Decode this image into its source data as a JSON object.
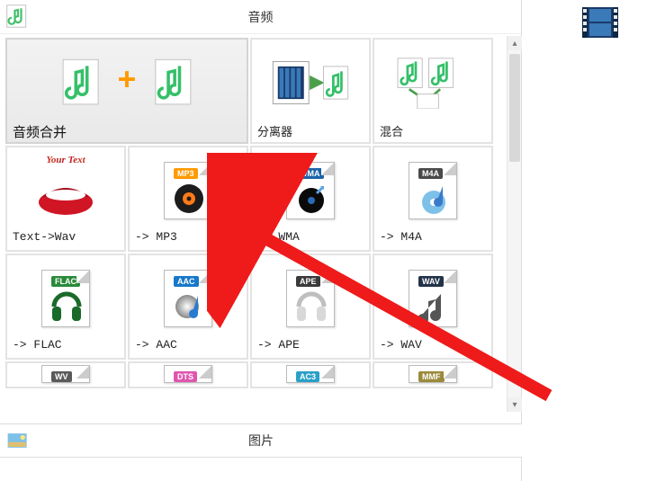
{
  "sections": {
    "audio_title": "音频",
    "pictures_title": "图片"
  },
  "tiles": {
    "merge": {
      "label": "音频合并"
    },
    "splitter": {
      "label": "分离器"
    },
    "mix": {
      "label": "混合"
    },
    "text2wav": {
      "label": "Text->Wav",
      "badge_text": "Your Text"
    },
    "mp3": {
      "label": "-> MP3",
      "badge": "MP3",
      "badge_color": "#ff9a00"
    },
    "wma": {
      "label": "-> WMA",
      "badge": "WMA",
      "badge_color": "#1d63a8"
    },
    "m4a": {
      "label": "-> M4A",
      "badge": "M4A",
      "badge_color": "#4a4a4a"
    },
    "flac": {
      "label": "-> FLAC",
      "badge": "FLAC",
      "badge_color": "#2a8a3a"
    },
    "aac": {
      "label": "-> AAC",
      "badge": "AAC",
      "badge_color": "#1878c9"
    },
    "ape": {
      "label": "-> APE",
      "badge": "APE",
      "badge_color": "#3a3a3a"
    },
    "wav": {
      "label": "-> WAV",
      "badge": "WAV",
      "badge_color": "#223349"
    },
    "wv": {
      "label": "",
      "badge": "WV",
      "badge_color": "#5a5a5a"
    },
    "dts": {
      "label": "",
      "badge": "DTS",
      "badge_color": "#e055b0"
    },
    "ac3": {
      "label": "",
      "badge": "AC3",
      "badge_color": "#2aa0c8"
    },
    "mmf": {
      "label": "",
      "badge": "MMF",
      "badge_color": "#9a8a3a"
    }
  }
}
